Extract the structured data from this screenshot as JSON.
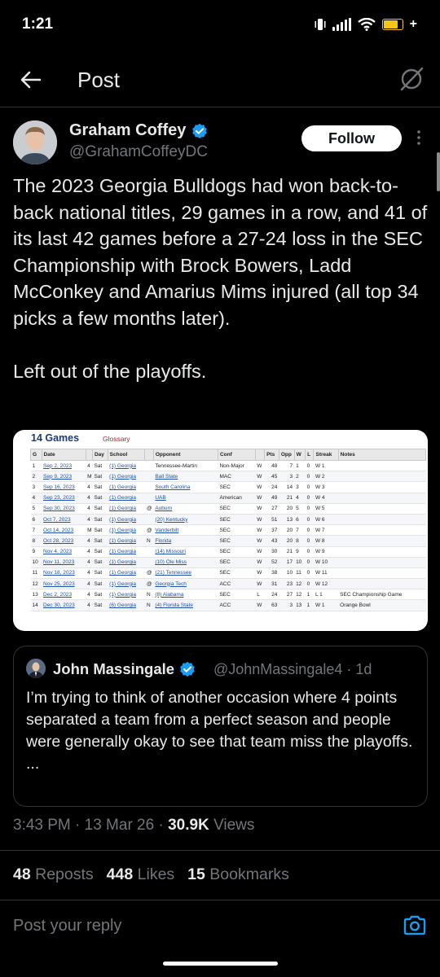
{
  "status_bar": {
    "time": "1:21",
    "icons": [
      "vibrate-icon",
      "signal-icon",
      "wifi-icon",
      "battery-charging-icon"
    ]
  },
  "nav": {
    "title": "Post"
  },
  "post": {
    "author_name": "Graham Coffey",
    "handle": "@GrahamCoffeyDC",
    "follow_label": "Follow",
    "text": "The 2023 Georgia Bulldogs had won back-to-back national titles, 29 games in a row, and 41 of its last 42 games before a 27-24 loss in the SEC Championship with Brock Bowers, Ladd McConkey and Amarius Mims injured (all top 34 picks a few months later).\n\nLeft out of the playoffs.",
    "timestamp": "3:43 PM · 13 Mar 26 ·",
    "views_count": "30.9K",
    "views_label": "Views"
  },
  "media_table": {
    "title": "14 Games",
    "glossary": "Glossary",
    "headers": [
      "G",
      "Date",
      "",
      "Day",
      "School",
      "",
      "Opponent",
      "Conf",
      "",
      "Pts",
      "Opp",
      "W",
      "L",
      "Streak",
      "Notes"
    ],
    "rows": [
      [
        "1",
        "Sep 2, 2023",
        "4",
        "Sat",
        "(1) Georgia",
        "",
        "Tennessee-Martin",
        "Non-Major",
        "W",
        "48",
        "7",
        "1",
        "0",
        "W 1",
        ""
      ],
      [
        "2",
        "Sep 9, 2023",
        "M",
        "Sat",
        "(1) Georgia",
        "",
        "Ball State",
        "MAC",
        "W",
        "45",
        "3",
        "2",
        "0",
        "W 2",
        ""
      ],
      [
        "3",
        "Sep 16, 2023",
        "4",
        "Sat",
        "(1) Georgia",
        "",
        "South Carolina",
        "SEC",
        "W",
        "24",
        "14",
        "3",
        "0",
        "W 3",
        ""
      ],
      [
        "4",
        "Sep 23, 2023",
        "4",
        "Sat",
        "(1) Georgia",
        "",
        "UAB",
        "American",
        "W",
        "49",
        "21",
        "4",
        "0",
        "W 4",
        ""
      ],
      [
        "5",
        "Sep 30, 2023",
        "4",
        "Sat",
        "(1) Georgia",
        "@",
        "Auburn",
        "SEC",
        "W",
        "27",
        "20",
        "5",
        "0",
        "W 5",
        ""
      ],
      [
        "6",
        "Oct 7, 2023",
        "4",
        "Sat",
        "(1) Georgia",
        "",
        "(20) Kentucky",
        "SEC",
        "W",
        "51",
        "13",
        "6",
        "0",
        "W 6",
        ""
      ],
      [
        "7",
        "Oct 14, 2023",
        "M",
        "Sat",
        "(1) Georgia",
        "@",
        "Vanderbilt",
        "SEC",
        "W",
        "37",
        "20",
        "7",
        "0",
        "W 7",
        ""
      ],
      [
        "8",
        "Oct 28, 2023",
        "4",
        "Sat",
        "(1) Georgia",
        "N",
        "Florida",
        "SEC",
        "W",
        "43",
        "20",
        "8",
        "0",
        "W 8",
        ""
      ],
      [
        "9",
        "Nov 4, 2023",
        "4",
        "Sat",
        "(1) Georgia",
        "",
        "(14) Missouri",
        "SEC",
        "W",
        "30",
        "21",
        "9",
        "0",
        "W 9",
        ""
      ],
      [
        "10",
        "Nov 11, 2023",
        "4",
        "Sat",
        "(1) Georgia",
        "",
        "(10) Ole Miss",
        "SEC",
        "W",
        "52",
        "17",
        "10",
        "0",
        "W 10",
        ""
      ],
      [
        "11",
        "Nov 18, 2023",
        "4",
        "Sat",
        "(1) Georgia",
        "@",
        "(21) Tennessee",
        "SEC",
        "W",
        "38",
        "10",
        "11",
        "0",
        "W 11",
        ""
      ],
      [
        "12",
        "Nov 25, 2023",
        "4",
        "Sat",
        "(1) Georgia",
        "@",
        "Georgia Tech",
        "ACC",
        "W",
        "31",
        "23",
        "12",
        "0",
        "W 12",
        ""
      ],
      [
        "13",
        "Dec 2, 2023",
        "4",
        "Sat",
        "(1) Georgia",
        "N",
        "(8) Alabama",
        "SEC",
        "L",
        "24",
        "27",
        "12",
        "1",
        "L 1",
        "SEC Championship Game"
      ],
      [
        "14",
        "Dec 30, 2023",
        "4",
        "Sat",
        "(6) Georgia",
        "N",
        "(4) Florida State",
        "ACC",
        "W",
        "63",
        "3",
        "13",
        "1",
        "W 1",
        "Orange Bowl"
      ]
    ]
  },
  "quote": {
    "author_name": "John Massingale",
    "handle": "@JohnMassingale4 · 1d",
    "text": "I’m trying to think of another occasion where 4 points separated a team from a perfect season and people were generally okay to see that team miss the playoffs.\n..."
  },
  "stats": {
    "reposts_count": "48",
    "reposts_label": "Reposts",
    "likes_count": "448",
    "likes_label": "Likes",
    "bookmarks_count": "15",
    "bookmarks_label": "Bookmarks"
  },
  "reply": {
    "placeholder": "Post your reply"
  },
  "colors": {
    "background": "#000000",
    "text": "#e7e9ea",
    "muted": "#71767b",
    "verified": "#1d9bf0",
    "accent": "#1d9bf0",
    "battery": "#f5c518"
  }
}
